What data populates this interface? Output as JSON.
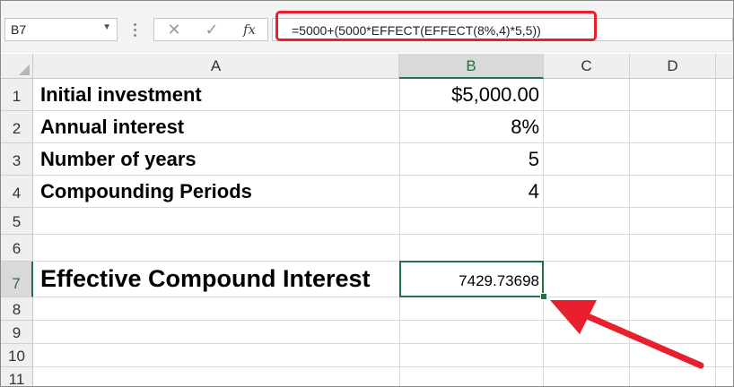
{
  "name_box": {
    "value": "B7"
  },
  "formula_bar": {
    "formula": "=5000+(5000*EFFECT(EFFECT(8%,4)*5,5))"
  },
  "columns": [
    "A",
    "B",
    "C",
    "D"
  ],
  "rows": [
    "1",
    "2",
    "3",
    "4",
    "5",
    "6",
    "7",
    "8",
    "9",
    "10",
    "11"
  ],
  "cells": {
    "a1": "Initial investment",
    "b1": "$5,000.00",
    "a2": "Annual interest",
    "b2": "8%",
    "a3": "Number of years",
    "b3": "5",
    "a4": "Compounding Periods",
    "b4": "4",
    "a7": "Effective Compound Interest",
    "b7": "7429.73698"
  },
  "icons": {
    "name_box_dropdown": "chevron-down-icon",
    "cancel": "close-icon",
    "enter": "check-icon",
    "insert_function": "fx-icon"
  },
  "colors": {
    "accent": "#217346",
    "highlight": "#e8202e",
    "header_bg": "#efefef"
  }
}
